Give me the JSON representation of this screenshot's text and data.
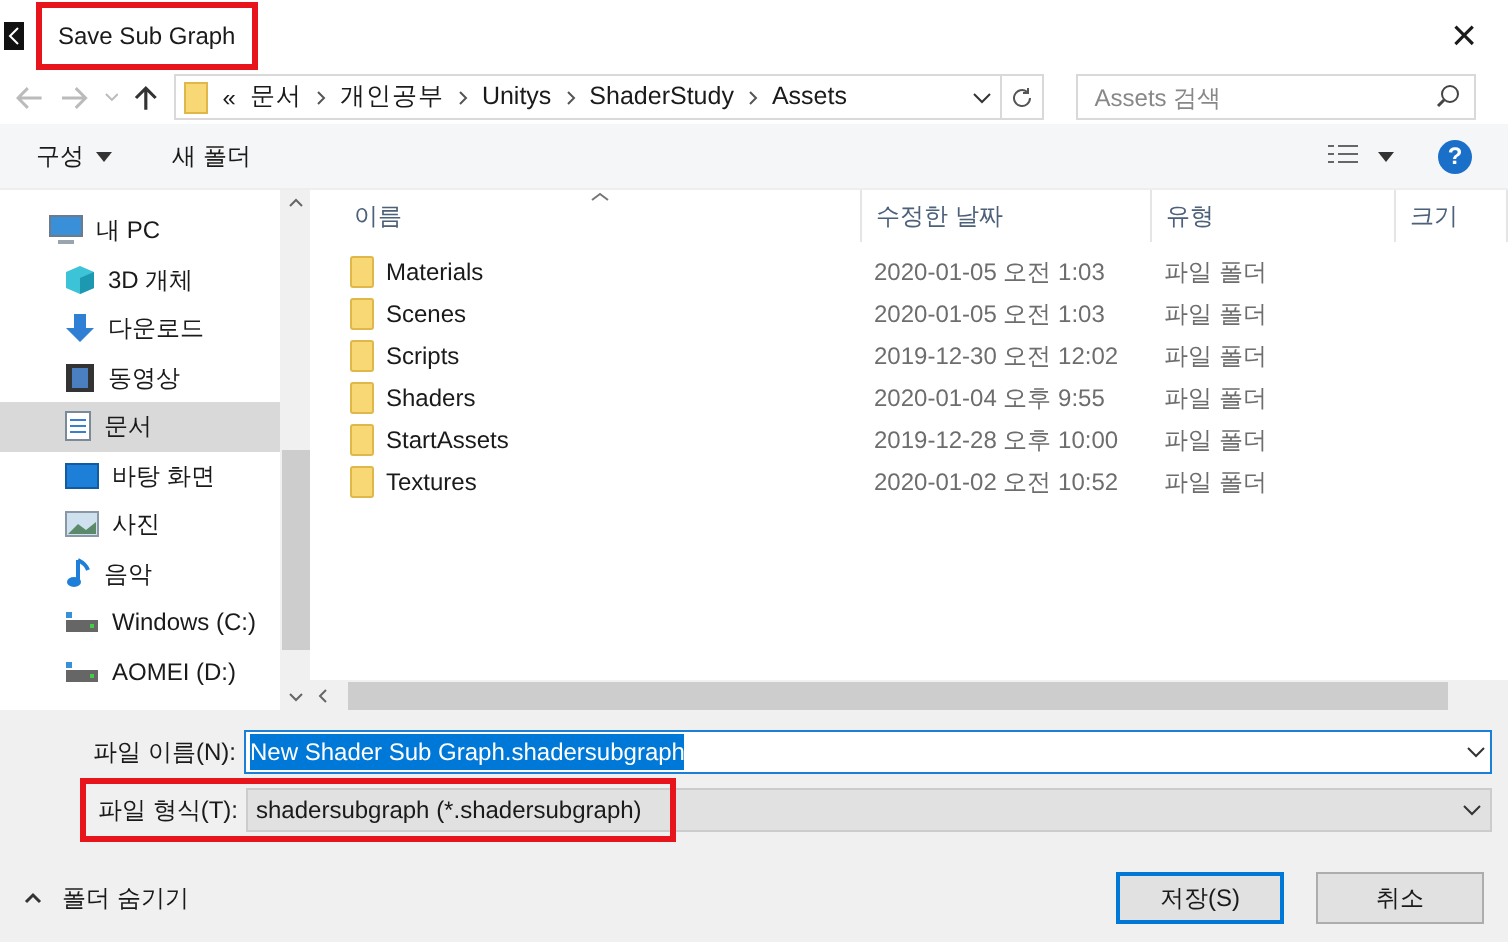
{
  "window": {
    "title": "Save Sub Graph",
    "title_highlighted": true,
    "close": "×"
  },
  "address_bar": {
    "prefix": "«",
    "segments": [
      "문서",
      "개인공부",
      "Unitys",
      "ShaderStudy",
      "Assets"
    ]
  },
  "search": {
    "placeholder": "Assets 검색"
  },
  "toolbar": {
    "organize": "구성",
    "new_folder": "새 폴더",
    "help": "?"
  },
  "sidebar": {
    "items": [
      {
        "label": "내 PC",
        "kind": "pc",
        "selected": false
      },
      {
        "label": "3D 개체",
        "kind": "cube",
        "selected": false
      },
      {
        "label": "다운로드",
        "kind": "download",
        "selected": false
      },
      {
        "label": "동영상",
        "kind": "video",
        "selected": false
      },
      {
        "label": "문서",
        "kind": "document",
        "selected": true
      },
      {
        "label": "바탕 화면",
        "kind": "desktop",
        "selected": false
      },
      {
        "label": "사진",
        "kind": "picture",
        "selected": false
      },
      {
        "label": "음악",
        "kind": "music",
        "selected": false
      },
      {
        "label": "Windows (C:)",
        "kind": "drive",
        "selected": false
      },
      {
        "label": "AOMEI (D:)",
        "kind": "drive",
        "selected": false
      }
    ]
  },
  "table": {
    "columns": [
      "이름",
      "수정한 날짜",
      "유형",
      "크기"
    ],
    "rows": [
      {
        "name": "Materials",
        "date": "2020-01-05 오전 1:03",
        "type": "파일 폴더"
      },
      {
        "name": "Scenes",
        "date": "2020-01-05 오전 1:03",
        "type": "파일 폴더"
      },
      {
        "name": "Scripts",
        "date": "2019-12-30 오전 12:02",
        "type": "파일 폴더"
      },
      {
        "name": "Shaders",
        "date": "2020-01-04 오후 9:55",
        "type": "파일 폴더"
      },
      {
        "name": "StartAssets",
        "date": "2019-12-28 오후 10:00",
        "type": "파일 폴더"
      },
      {
        "name": "Textures",
        "date": "2020-01-02 오전 10:52",
        "type": "파일 폴더"
      }
    ]
  },
  "file_name": {
    "label": "파일 이름(N):",
    "value": "New Shader Sub Graph.shadersubgraph"
  },
  "file_type": {
    "label": "파일 형식(T):",
    "value": "shadersubgraph (*.shadersubgraph)",
    "highlighted": true
  },
  "hide_folders": "폴더 숨기기",
  "buttons": [
    {
      "label": "저장(S)",
      "primary": true
    },
    {
      "label": "취소",
      "primary": false
    }
  ]
}
